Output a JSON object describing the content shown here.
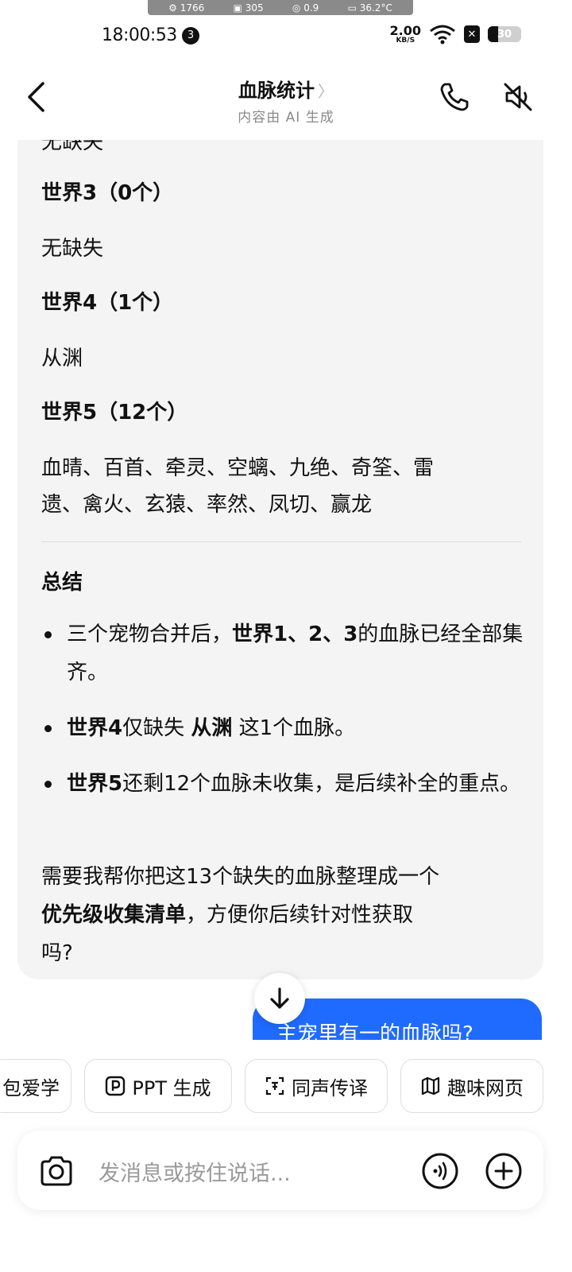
{
  "debug_bar": {
    "cpu": "1766",
    "gpu": "305",
    "signal": "0.9",
    "temp": "36.2°C"
  },
  "status_bar": {
    "time": "18:00:53",
    "notification_count": "3",
    "net_speed_value": "2.00",
    "net_speed_unit": "KB/S",
    "battery_level": "30"
  },
  "header": {
    "title": "血脉统计",
    "title_chevron": "〉",
    "subtitle": "内容由 AI 生成"
  },
  "message": {
    "partial_top": "无缺失",
    "sections": [
      {
        "heading": "世界3（0个）",
        "content": "无缺失"
      },
      {
        "heading": "世界4（1个）",
        "content": "从渊"
      },
      {
        "heading": "世界5（12个）",
        "content_line1": "血晴、百首、牵灵、空螭、九绝、奇筌、雷",
        "content_line2": "遗、禽火、玄猿、率然、凤切、赢龙"
      }
    ],
    "summary_heading": "总结",
    "bullets": [
      {
        "bold": "",
        "pre": "三个宠物合并后，",
        "bold2": "世界1、2、3",
        "post": "的血脉已经全部集齐。"
      },
      {
        "bold": "世界4",
        "pre": "仅缺失 ",
        "bold2": "从渊",
        "post": " 这1个血脉。"
      },
      {
        "bold": "世界5",
        "pre": "还剩12个血脉未收集，是后续补全的重点。",
        "bold2": "",
        "post": ""
      }
    ],
    "closing_line1": "需要我帮你把这13个缺失的血脉整理成一个",
    "closing_bold": "优先级收集清单",
    "closing_line2_rest": "，方便你后续针对性获取",
    "closing_line3": "吗?"
  },
  "user_bubble": {
    "text": "主宠里有一的血脉吗?"
  },
  "chips": [
    {
      "label": "包爱学",
      "icon": ""
    },
    {
      "label": "PPT 生成",
      "icon": "ppt-icon"
    },
    {
      "label": "同声传译",
      "icon": "translate-icon"
    },
    {
      "label": "趣味网页",
      "icon": "map-icon"
    }
  ],
  "input": {
    "placeholder": "发消息或按住说话..."
  },
  "colors": {
    "accent": "#1f6bff",
    "card_bg": "#f4f4f4",
    "muted": "#9a9a9a"
  }
}
